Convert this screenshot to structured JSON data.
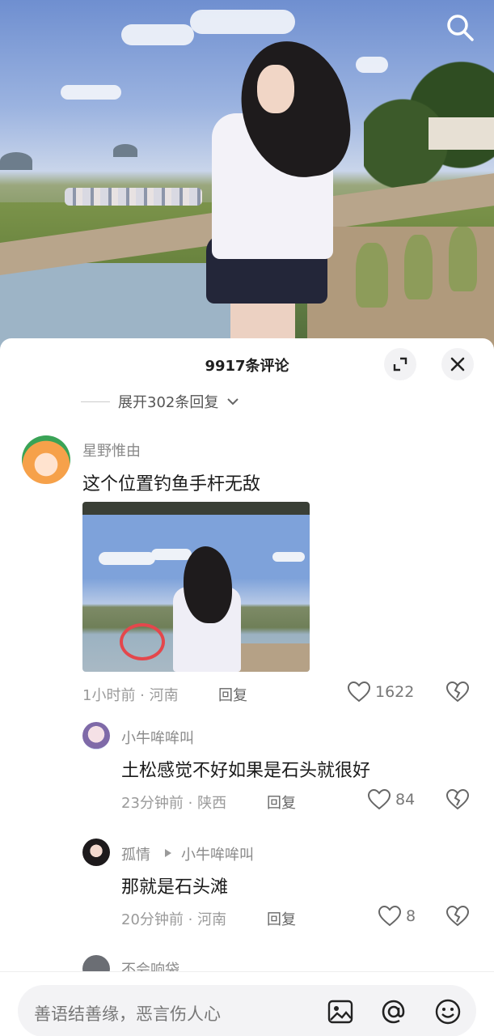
{
  "video": {
    "search_icon": "search-icon"
  },
  "panel": {
    "title": "9917条评论",
    "expand_icon": "collapse-expand-icon",
    "close_icon": "close-icon",
    "expand_replies": "展开302条回复"
  },
  "comments": [
    {
      "username": "星野惟由",
      "text": "这个位置钓鱼手杆无敌",
      "time_location": "1小时前 · 河南",
      "reply_label": "回复",
      "likes": "1622",
      "has_image": true
    },
    {
      "username": "小牛哞哞叫",
      "text": "土松感觉不好如果是石头就很好",
      "time_location": "23分钟前 · 陕西",
      "reply_label": "回复",
      "likes": "84"
    },
    {
      "username": "孤情",
      "reply_to": "小牛哞哞叫",
      "text": "那就是石头滩",
      "time_location": "20分钟前 · 河南",
      "reply_label": "回复",
      "likes": "8"
    },
    {
      "username": "不会响袋"
    }
  ],
  "input": {
    "placeholder": "善语结善缘，恶言伤人心",
    "image_icon": "image-icon",
    "mention_icon": "at-mention-icon",
    "emoji_icon": "emoji-icon"
  },
  "colors": {
    "highlight_circle": "#e4474c",
    "panel_bg": "#ffffff"
  }
}
